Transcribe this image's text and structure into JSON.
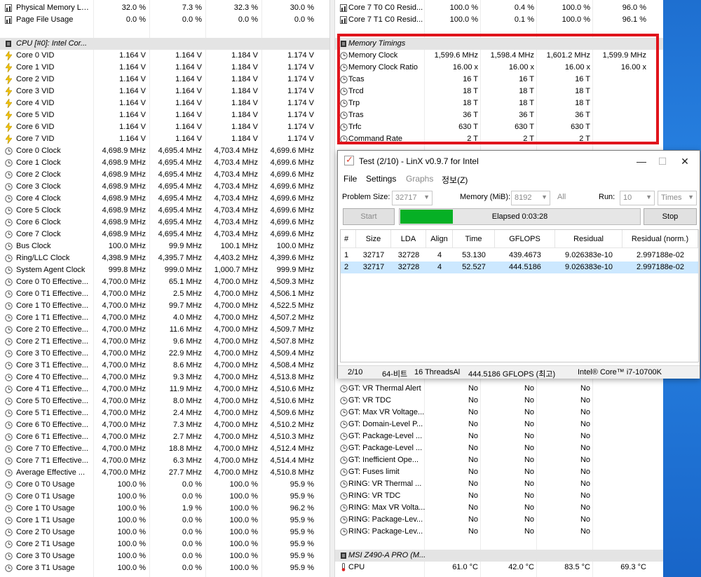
{
  "left_rows": [
    {
      "type": "bar",
      "label": "Physical Memory Load",
      "v": [
        "32.0 %",
        "7.3 %",
        "32.3 %",
        "30.0 %"
      ]
    },
    {
      "type": "bar",
      "label": "Page File Usage",
      "v": [
        "0.0 %",
        "0.0 %",
        "0.0 %",
        "0.0 %"
      ]
    },
    {
      "type": "blank"
    },
    {
      "type": "section",
      "label": "CPU [#0]: Intel Cor..."
    },
    {
      "type": "volt",
      "label": "Core 0 VID",
      "v": [
        "1.164 V",
        "1.164 V",
        "1.184 V",
        "1.174 V"
      ]
    },
    {
      "type": "volt",
      "label": "Core 1 VID",
      "v": [
        "1.164 V",
        "1.164 V",
        "1.184 V",
        "1.174 V"
      ]
    },
    {
      "type": "volt",
      "label": "Core 2 VID",
      "v": [
        "1.164 V",
        "1.164 V",
        "1.184 V",
        "1.174 V"
      ]
    },
    {
      "type": "volt",
      "label": "Core 3 VID",
      "v": [
        "1.164 V",
        "1.164 V",
        "1.184 V",
        "1.174 V"
      ]
    },
    {
      "type": "volt",
      "label": "Core 4 VID",
      "v": [
        "1.164 V",
        "1.164 V",
        "1.184 V",
        "1.174 V"
      ]
    },
    {
      "type": "volt",
      "label": "Core 5 VID",
      "v": [
        "1.164 V",
        "1.164 V",
        "1.184 V",
        "1.174 V"
      ]
    },
    {
      "type": "volt",
      "label": "Core 6 VID",
      "v": [
        "1.164 V",
        "1.164 V",
        "1.184 V",
        "1.174 V"
      ]
    },
    {
      "type": "volt",
      "label": "Core 7 VID",
      "v": [
        "1.164 V",
        "1.164 V",
        "1.184 V",
        "1.174 V"
      ]
    },
    {
      "type": "clock",
      "label": "Core 0 Clock",
      "v": [
        "4,698.9 MHz",
        "4,695.4 MHz",
        "4,703.4 MHz",
        "4,699.6 MHz"
      ]
    },
    {
      "type": "clock",
      "label": "Core 1 Clock",
      "v": [
        "4,698.9 MHz",
        "4,695.4 MHz",
        "4,703.4 MHz",
        "4,699.6 MHz"
      ]
    },
    {
      "type": "clock",
      "label": "Core 2 Clock",
      "v": [
        "4,698.9 MHz",
        "4,695.4 MHz",
        "4,703.4 MHz",
        "4,699.6 MHz"
      ]
    },
    {
      "type": "clock",
      "label": "Core 3 Clock",
      "v": [
        "4,698.9 MHz",
        "4,695.4 MHz",
        "4,703.4 MHz",
        "4,699.6 MHz"
      ]
    },
    {
      "type": "clock",
      "label": "Core 4 Clock",
      "v": [
        "4,698.9 MHz",
        "4,695.4 MHz",
        "4,703.4 MHz",
        "4,699.6 MHz"
      ]
    },
    {
      "type": "clock",
      "label": "Core 5 Clock",
      "v": [
        "4,698.9 MHz",
        "4,695.4 MHz",
        "4,703.4 MHz",
        "4,699.6 MHz"
      ]
    },
    {
      "type": "clock",
      "label": "Core 6 Clock",
      "v": [
        "4,698.9 MHz",
        "4,695.4 MHz",
        "4,703.4 MHz",
        "4,699.6 MHz"
      ]
    },
    {
      "type": "clock",
      "label": "Core 7 Clock",
      "v": [
        "4,698.9 MHz",
        "4,695.4 MHz",
        "4,703.4 MHz",
        "4,699.6 MHz"
      ]
    },
    {
      "type": "clock",
      "label": "Bus Clock",
      "v": [
        "100.0 MHz",
        "99.9 MHz",
        "100.1 MHz",
        "100.0 MHz"
      ]
    },
    {
      "type": "clock",
      "label": "Ring/LLC Clock",
      "v": [
        "4,398.9 MHz",
        "4,395.7 MHz",
        "4,403.2 MHz",
        "4,399.6 MHz"
      ]
    },
    {
      "type": "clock",
      "label": "System Agent Clock",
      "v": [
        "999.8 MHz",
        "999.0 MHz",
        "1,000.7 MHz",
        "999.9 MHz"
      ]
    },
    {
      "type": "clock",
      "label": "Core 0 T0 Effective...",
      "v": [
        "4,700.0 MHz",
        "65.1 MHz",
        "4,700.0 MHz",
        "4,509.3 MHz"
      ]
    },
    {
      "type": "clock",
      "label": "Core 0 T1 Effective...",
      "v": [
        "4,700.0 MHz",
        "2.5 MHz",
        "4,700.0 MHz",
        "4,506.1 MHz"
      ]
    },
    {
      "type": "clock",
      "label": "Core 1 T0 Effective...",
      "v": [
        "4,700.0 MHz",
        "99.7 MHz",
        "4,700.0 MHz",
        "4,522.5 MHz"
      ]
    },
    {
      "type": "clock",
      "label": "Core 1 T1 Effective...",
      "v": [
        "4,700.0 MHz",
        "4.0 MHz",
        "4,700.0 MHz",
        "4,507.2 MHz"
      ]
    },
    {
      "type": "clock",
      "label": "Core 2 T0 Effective...",
      "v": [
        "4,700.0 MHz",
        "11.6 MHz",
        "4,700.0 MHz",
        "4,509.7 MHz"
      ]
    },
    {
      "type": "clock",
      "label": "Core 2 T1 Effective...",
      "v": [
        "4,700.0 MHz",
        "9.6 MHz",
        "4,700.0 MHz",
        "4,507.8 MHz"
      ]
    },
    {
      "type": "clock",
      "label": "Core 3 T0 Effective...",
      "v": [
        "4,700.0 MHz",
        "22.9 MHz",
        "4,700.0 MHz",
        "4,509.4 MHz"
      ]
    },
    {
      "type": "clock",
      "label": "Core 3 T1 Effective...",
      "v": [
        "4,700.0 MHz",
        "8.6 MHz",
        "4,700.0 MHz",
        "4,508.4 MHz"
      ]
    },
    {
      "type": "clock",
      "label": "Core 4 T0 Effective...",
      "v": [
        "4,700.0 MHz",
        "9.3 MHz",
        "4,700.0 MHz",
        "4,513.8 MHz"
      ]
    },
    {
      "type": "clock",
      "label": "Core 4 T1 Effective...",
      "v": [
        "4,700.0 MHz",
        "11.9 MHz",
        "4,700.0 MHz",
        "4,510.6 MHz"
      ]
    },
    {
      "type": "clock",
      "label": "Core 5 T0 Effective...",
      "v": [
        "4,700.0 MHz",
        "8.0 MHz",
        "4,700.0 MHz",
        "4,510.6 MHz"
      ]
    },
    {
      "type": "clock",
      "label": "Core 5 T1 Effective...",
      "v": [
        "4,700.0 MHz",
        "2.4 MHz",
        "4,700.0 MHz",
        "4,509.6 MHz"
      ]
    },
    {
      "type": "clock",
      "label": "Core 6 T0 Effective...",
      "v": [
        "4,700.0 MHz",
        "7.3 MHz",
        "4,700.0 MHz",
        "4,510.2 MHz"
      ]
    },
    {
      "type": "clock",
      "label": "Core 6 T1 Effective...",
      "v": [
        "4,700.0 MHz",
        "2.7 MHz",
        "4,700.0 MHz",
        "4,510.3 MHz"
      ]
    },
    {
      "type": "clock",
      "label": "Core 7 T0 Effective...",
      "v": [
        "4,700.0 MHz",
        "18.8 MHz",
        "4,700.0 MHz",
        "4,512.4 MHz"
      ]
    },
    {
      "type": "clock",
      "label": "Core 7 T1 Effective...",
      "v": [
        "4,700.0 MHz",
        "6.3 MHz",
        "4,700.0 MHz",
        "4,514.4 MHz"
      ]
    },
    {
      "type": "clock",
      "label": "Average Effective ...",
      "v": [
        "4,700.0 MHz",
        "27.7 MHz",
        "4,700.0 MHz",
        "4,510.8 MHz"
      ]
    },
    {
      "type": "usage",
      "label": "Core 0 T0 Usage",
      "v": [
        "100.0 %",
        "0.0 %",
        "100.0 %",
        "95.9 %"
      ]
    },
    {
      "type": "usage",
      "label": "Core 0 T1 Usage",
      "v": [
        "100.0 %",
        "0.0 %",
        "100.0 %",
        "95.9 %"
      ]
    },
    {
      "type": "usage",
      "label": "Core 1 T0 Usage",
      "v": [
        "100.0 %",
        "1.9 %",
        "100.0 %",
        "96.2 %"
      ]
    },
    {
      "type": "usage",
      "label": "Core 1 T1 Usage",
      "v": [
        "100.0 %",
        "0.0 %",
        "100.0 %",
        "95.9 %"
      ]
    },
    {
      "type": "usage",
      "label": "Core 2 T0 Usage",
      "v": [
        "100.0 %",
        "0.0 %",
        "100.0 %",
        "95.9 %"
      ]
    },
    {
      "type": "usage",
      "label": "Core 2 T1 Usage",
      "v": [
        "100.0 %",
        "0.0 %",
        "100.0 %",
        "95.9 %"
      ]
    },
    {
      "type": "usage",
      "label": "Core 3 T0 Usage",
      "v": [
        "100.0 %",
        "0.0 %",
        "100.0 %",
        "95.9 %"
      ]
    },
    {
      "type": "usage",
      "label": "Core 3 T1 Usage",
      "v": [
        "100.0 %",
        "0.0 %",
        "100.0 %",
        "95.9 %"
      ]
    }
  ],
  "right_rows_top": [
    {
      "type": "bar",
      "label": "Core 7 T0 C0 Resid...",
      "v": [
        "100.0 %",
        "0.4 %",
        "100.0 %",
        "96.0 %"
      ]
    },
    {
      "type": "bar",
      "label": "Core 7 T1 C0 Resid...",
      "v": [
        "100.0 %",
        "0.1 %",
        "100.0 %",
        "96.1 %"
      ]
    },
    {
      "type": "blank"
    },
    {
      "type": "section",
      "label": "Memory Timings"
    },
    {
      "type": "clock",
      "label": "Memory Clock",
      "v": [
        "1,599.6 MHz",
        "1,598.4 MHz",
        "1,601.2 MHz",
        "1,599.9 MHz"
      ]
    },
    {
      "type": "clock",
      "label": "Memory Clock Ratio",
      "v": [
        "16.00 x",
        "16.00 x",
        "16.00 x",
        "16.00 x"
      ]
    },
    {
      "type": "clock",
      "label": "Tcas",
      "v": [
        "16 T",
        "16 T",
        "16 T",
        ""
      ]
    },
    {
      "type": "clock",
      "label": "Trcd",
      "v": [
        "18 T",
        "18 T",
        "18 T",
        ""
      ]
    },
    {
      "type": "clock",
      "label": "Trp",
      "v": [
        "18 T",
        "18 T",
        "18 T",
        ""
      ]
    },
    {
      "type": "clock",
      "label": "Tras",
      "v": [
        "36 T",
        "36 T",
        "36 T",
        ""
      ]
    },
    {
      "type": "clock",
      "label": "Trfc",
      "v": [
        "630 T",
        "630 T",
        "630 T",
        ""
      ]
    },
    {
      "type": "clock",
      "label": "Command Rate",
      "v": [
        "2 T",
        "2 T",
        "2 T",
        ""
      ]
    }
  ],
  "right_rows_bottom": [
    {
      "type": "clock",
      "label": "GT: VR Thermal Alert",
      "v": [
        "No",
        "No",
        "No",
        ""
      ]
    },
    {
      "type": "clock",
      "label": "GT: VR TDC",
      "v": [
        "No",
        "No",
        "No",
        ""
      ]
    },
    {
      "type": "clock",
      "label": "GT: Max VR Voltage...",
      "v": [
        "No",
        "No",
        "No",
        ""
      ]
    },
    {
      "type": "clock",
      "label": "GT: Domain-Level P...",
      "v": [
        "No",
        "No",
        "No",
        ""
      ]
    },
    {
      "type": "clock",
      "label": "GT: Package-Level ...",
      "v": [
        "No",
        "No",
        "No",
        ""
      ]
    },
    {
      "type": "clock",
      "label": "GT: Package-Level ...",
      "v": [
        "No",
        "No",
        "No",
        ""
      ]
    },
    {
      "type": "clock",
      "label": "GT: Inefficient Ope...",
      "v": [
        "No",
        "No",
        "No",
        ""
      ]
    },
    {
      "type": "clock",
      "label": "GT: Fuses limit",
      "v": [
        "No",
        "No",
        "No",
        ""
      ]
    },
    {
      "type": "clock",
      "label": "RING: VR Thermal ...",
      "v": [
        "No",
        "No",
        "No",
        ""
      ]
    },
    {
      "type": "clock",
      "label": "RING: VR TDC",
      "v": [
        "No",
        "No",
        "No",
        ""
      ]
    },
    {
      "type": "clock",
      "label": "RING: Max VR Volta...",
      "v": [
        "No",
        "No",
        "No",
        ""
      ]
    },
    {
      "type": "clock",
      "label": "RING: Package-Lev...",
      "v": [
        "No",
        "No",
        "No",
        ""
      ]
    },
    {
      "type": "clock",
      "label": "RING: Package-Lev...",
      "v": [
        "No",
        "No",
        "No",
        ""
      ]
    },
    {
      "type": "blank"
    },
    {
      "type": "section",
      "label": "MSI Z490-A PRO (M..."
    },
    {
      "type": "temp",
      "label": "CPU",
      "v": [
        "61.0 °C",
        "42.0 °C",
        "83.5 °C",
        "69.3 °C"
      ]
    }
  ],
  "linx": {
    "title": "Test (2/10) - LinX v0.9.7 for Intel",
    "menu": {
      "file": "File",
      "settings": "Settings",
      "graphs": "Graphs",
      "info": "정보(Z)"
    },
    "problem_size_label": "Problem Size:",
    "problem_size_value": "32717",
    "memory_label": "Memory (MiB):",
    "memory_value": "8192",
    "all_label": "All",
    "run_label": "Run:",
    "run_value": "10",
    "times_value": "Times",
    "start_label": "Start",
    "stop_label": "Stop",
    "elapsed": "Elapsed 0:03:28",
    "progress_fraction": 0.22,
    "columns": [
      "#",
      "Size",
      "LDA",
      "Align",
      "Time",
      "GFLOPS",
      "Residual",
      "Residual (norm.)"
    ],
    "rows": [
      [
        "1",
        "32717",
        "32728",
        "4",
        "53.130",
        "439.4673",
        "9.026383e-10",
        "2.997188e-02"
      ],
      [
        "2",
        "32717",
        "32728",
        "4",
        "52.527",
        "444.5186",
        "9.026383e-10",
        "2.997188e-02"
      ]
    ],
    "status": {
      "progress": "2/10",
      "bits": "64-비트",
      "threads": "16 ThreadsAl",
      "gflops": "444.5186 GFLOPS (최고)",
      "cpu": "Intel® Core™ i7-10700K"
    }
  },
  "colors": {
    "highlight": "#e0141c",
    "progress": "#06b025",
    "selected_row": "#cce8ff",
    "section_bg": "#e4e4e4"
  }
}
